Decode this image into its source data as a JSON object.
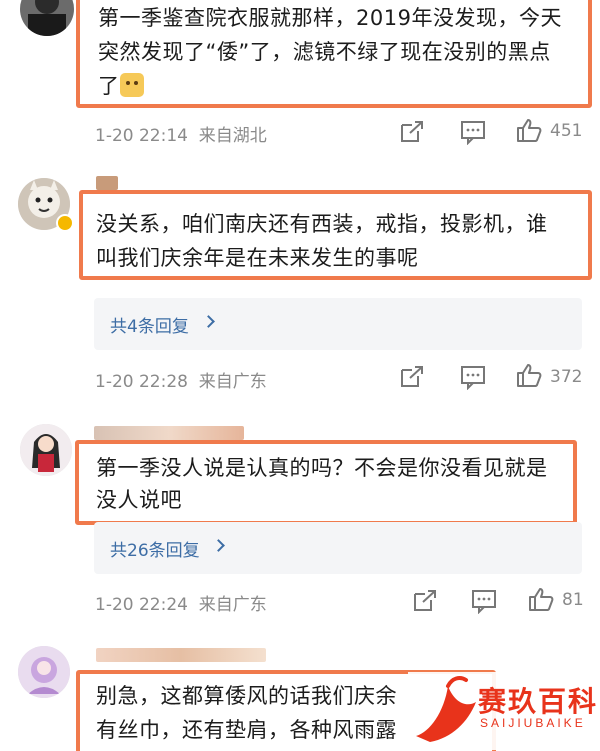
{
  "comments": [
    {
      "text_lines": [
        "第一季鉴查院衣服就那样，2019年没发现，今天",
        "突然发现了“倭”了，滤镜不绿了现在没别的黑点",
        "了"
      ],
      "emoji_icon": "doge-emoji-icon",
      "time": "1-20 22:14",
      "location": "来自湖北",
      "likes": "451"
    },
    {
      "text_lines": [
        "没关系，咱们南庆还有西装，戒指，投影机，谁",
        "叫我们庆余年是在未来发生的事呢"
      ],
      "replies": "共4条回复",
      "time": "1-20 22:28",
      "location": "来自广东",
      "likes": "372"
    },
    {
      "text_lines": [
        "第一季没人说是认真的吗？不会是你没看见就是",
        "没人说吧"
      ],
      "replies": "共26条回复",
      "time": "1-20 22:24",
      "location": "来自广东",
      "likes": "81"
    },
    {
      "text_lines": [
        "别急，这都算倭风的话我们庆余",
        "有丝巾，还有垫肩，各种风雨露"
      ]
    }
  ],
  "watermark": {
    "title": "赛玖百科",
    "subtitle": "SAIJIUBAIKE"
  },
  "colors": {
    "highlight": "#f07a4c",
    "reply_link": "#3d6da5",
    "meta_gray": "#8a8a8a",
    "watermark_red": "#e8331b"
  }
}
